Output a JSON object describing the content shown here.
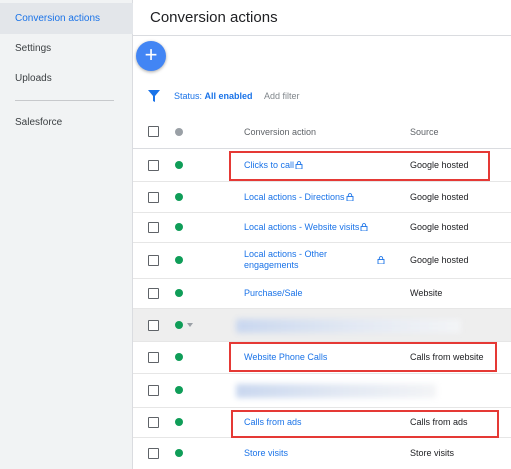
{
  "sidebar": {
    "items": [
      {
        "label": "Conversion actions",
        "active": true
      },
      {
        "label": "Settings",
        "active": false
      },
      {
        "label": "Uploads",
        "active": false
      },
      {
        "label": "Salesforce",
        "active": false
      }
    ]
  },
  "header": {
    "title": "Conversion actions"
  },
  "fab": {
    "label": "+"
  },
  "filter": {
    "status_label": "Status:",
    "status_value": "All enabled",
    "add_filter": "Add filter"
  },
  "table": {
    "columns": {
      "action": "Conversion action",
      "source": "Source"
    },
    "rows": [
      {
        "action": "Clicks to call",
        "source": "Google hosted",
        "status": "enabled",
        "locked": true,
        "highlighted": true
      },
      {
        "action": "Local actions - Directions",
        "source": "Google hosted",
        "status": "enabled",
        "locked": true
      },
      {
        "action": "Local actions - Website visits",
        "source": "Google hosted",
        "status": "enabled",
        "locked": true
      },
      {
        "action_line1": "Local actions - Other",
        "action_line2": "engagements",
        "source": "Google hosted",
        "status": "enabled",
        "locked": true
      },
      {
        "action": "Purchase/Sale",
        "source": "Website",
        "status": "enabled"
      },
      {
        "action": "",
        "source": "",
        "status": "enabled",
        "redacted": true,
        "expandable": true
      },
      {
        "action": "Website Phone Calls",
        "source": "Calls from website",
        "status": "enabled",
        "highlighted": true
      },
      {
        "action": "",
        "source": "",
        "status": "enabled",
        "redacted": true
      },
      {
        "action": "Calls from ads",
        "source": "Calls from ads",
        "status": "enabled",
        "highlighted": true
      },
      {
        "action": "Store visits",
        "source": "Store visits",
        "status": "enabled"
      }
    ]
  },
  "colors": {
    "accent": "#1a73e8",
    "fab": "#4285f4",
    "status_enabled": "#0f9d58",
    "highlight": "#e53935"
  },
  "icons": [
    "plus-icon",
    "filter-icon",
    "lock-icon",
    "chevron-down-icon"
  ]
}
